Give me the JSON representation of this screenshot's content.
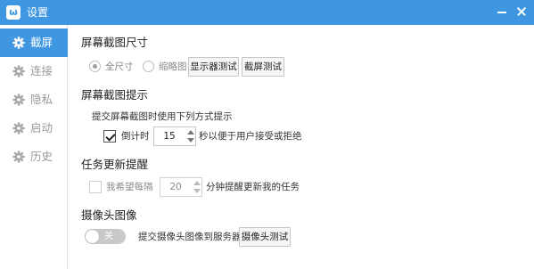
{
  "window": {
    "title": "设置",
    "logo": "ω",
    "logo_icon": "app-logo-icon",
    "accent": "#3f97e1"
  },
  "sidebar": {
    "items": [
      {
        "label": "截屏",
        "icon": "gear-icon",
        "active": true
      },
      {
        "label": "连接",
        "icon": "gear-icon",
        "active": false
      },
      {
        "label": "隐私",
        "icon": "gear-icon",
        "active": false
      },
      {
        "label": "启动",
        "icon": "gear-icon",
        "active": false
      },
      {
        "label": "历史",
        "icon": "gear-icon",
        "active": false
      }
    ]
  },
  "screenshot_size": {
    "title": "屏幕截图尺寸",
    "full_size_label": "全尺寸",
    "thumbnail_label": "缩略图",
    "selected": "全尺寸",
    "monitor_test_button": "显示器测试",
    "screenshot_test_button": "截屏测试"
  },
  "screenshot_notice": {
    "title": "屏幕截图提示",
    "description": "提交屏幕截图时使用下列方式提示",
    "countdown_label": "倒计时",
    "countdown_checked": true,
    "countdown_value": "15",
    "countdown_suffix": "秒以便于用户接受或拒绝"
  },
  "task_reminder": {
    "title": "任务更新提醒",
    "enable_label": "我希望每隔",
    "enable_checked": false,
    "minutes_value": "20",
    "minutes_suffix": "分钟提醒更新我的任务"
  },
  "camera": {
    "title": "摄像头图像",
    "toggle_label": "关",
    "toggle_on": false,
    "description": "提交摄像头图像到服务器",
    "camera_test_button": "摄像头测试"
  }
}
